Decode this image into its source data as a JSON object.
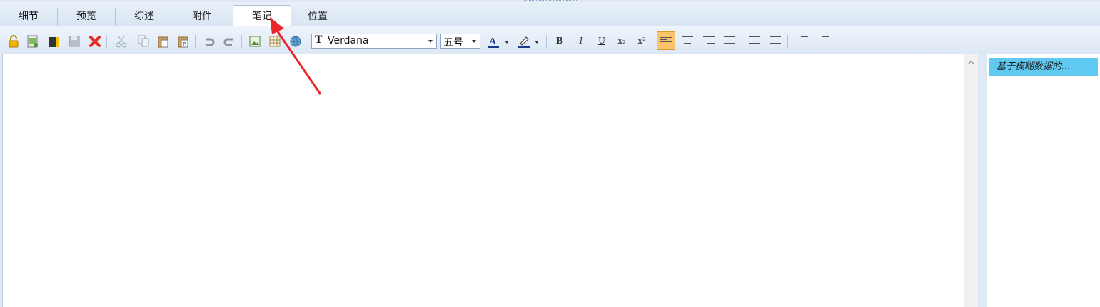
{
  "tabs": [
    {
      "label": "细节",
      "active": false
    },
    {
      "label": "预览",
      "active": false
    },
    {
      "label": "综述",
      "active": false
    },
    {
      "label": "附件",
      "active": false
    },
    {
      "label": "笔记",
      "active": true
    },
    {
      "label": "位置",
      "active": false
    }
  ],
  "toolbar": {
    "font_family": "Verdana",
    "font_size": "五号",
    "format_buttons": {
      "bold": "B",
      "italic": "I",
      "underline": "U",
      "subscript": "x₂",
      "superscript": "x²"
    },
    "font_icon_glyph": "Ŧ"
  },
  "side_panel": {
    "items": [
      "基于模糊数据的..."
    ]
  },
  "colors": {
    "accent": "#5fc9f2",
    "annotation_arrow": "#e8262c",
    "active_align": "#f9c46b"
  }
}
